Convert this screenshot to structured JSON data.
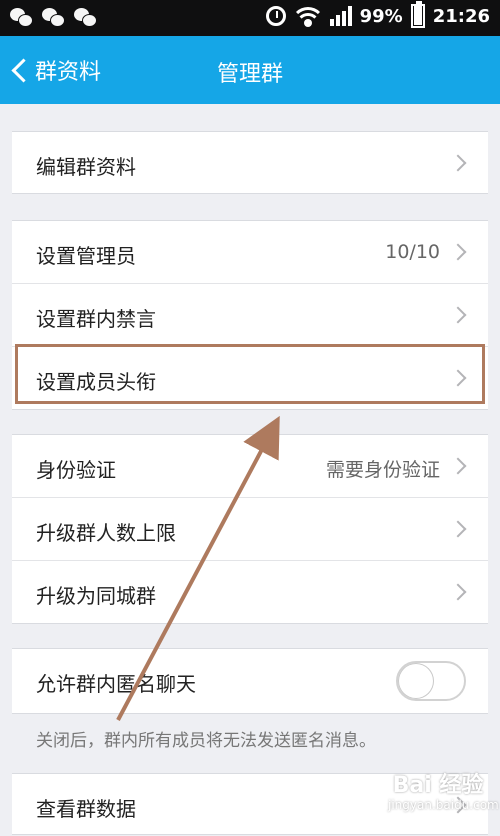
{
  "status": {
    "battery": "99%",
    "time": "21:26",
    "icons": [
      "wechat-icon",
      "wechat-icon",
      "wechat-icon",
      "alarm-icon",
      "wifi-icon",
      "signal-icon",
      "battery-icon"
    ]
  },
  "nav": {
    "back": "群资料",
    "title": "管理群"
  },
  "sections": {
    "edit": "编辑群资料",
    "admins": "设置管理员",
    "admins_value": "10/10",
    "mute": "设置群内禁言",
    "titles": "设置成员头衔",
    "verify": "身份验证",
    "verify_value": "需要身份验证",
    "upgrade_limit": "升级群人数上限",
    "upgrade_city": "升级为同城群",
    "anonymous": "允许群内匿名聊天",
    "anonymous_help": "关闭后，群内所有成员将无法发送匿名消息。",
    "data": "查看群数据"
  },
  "toggle": {
    "anonymous_on": false
  },
  "watermark": {
    "logo": "Bai 经验",
    "site": "jingyan.baidu.com"
  },
  "colors": {
    "nav": "#15a6e7",
    "highlight": "#ae7a5e"
  }
}
